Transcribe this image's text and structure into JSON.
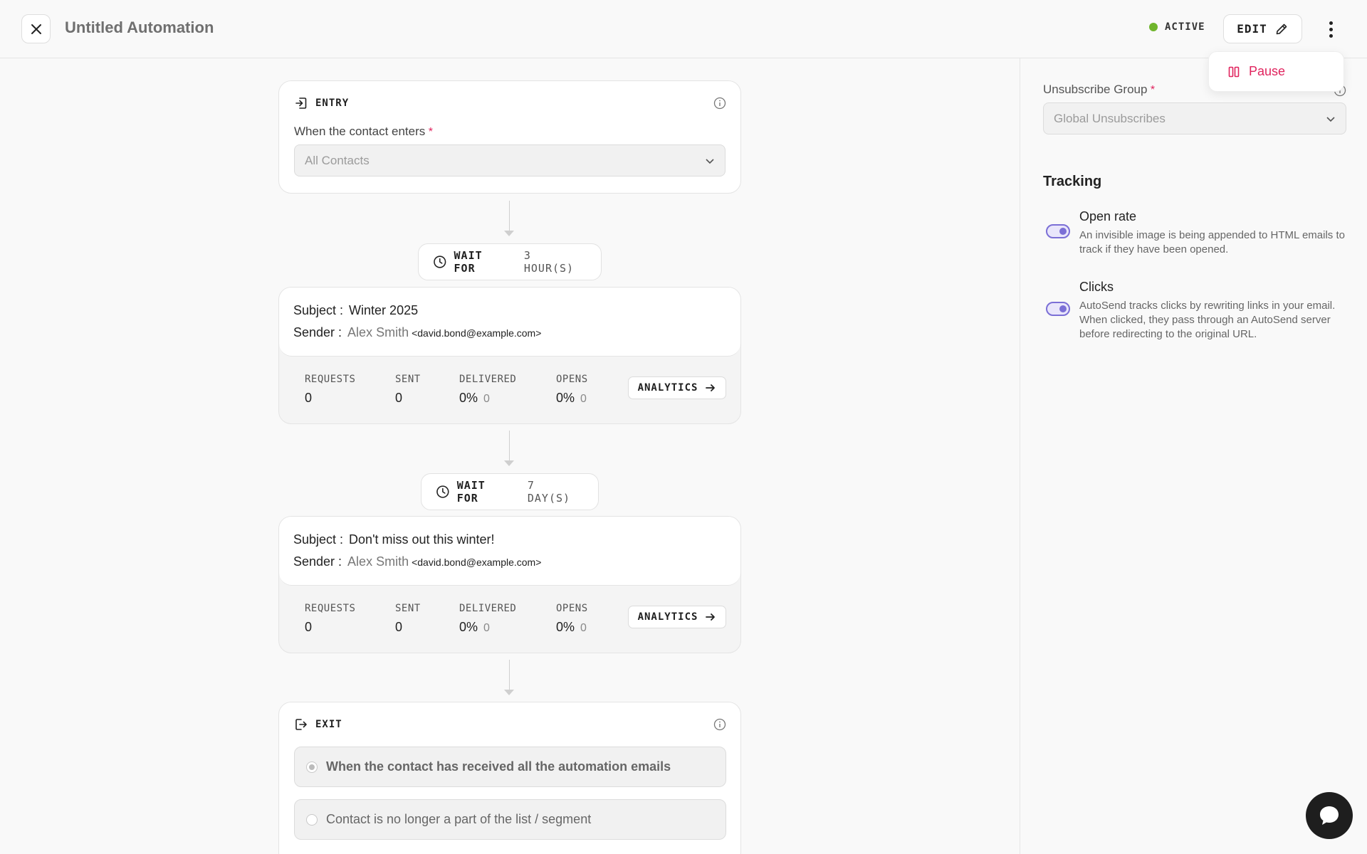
{
  "header": {
    "title": "Untitled Automation",
    "status": "ACTIVE",
    "edit_label": "EDIT"
  },
  "menu": {
    "pause_label": "Pause"
  },
  "entry": {
    "heading": "ENTRY",
    "field_label": "When the contact enters",
    "required_mark": "*",
    "selected": "All Contacts"
  },
  "waits": [
    {
      "label": "WAIT FOR",
      "value": "3 HOUR(S)"
    },
    {
      "label": "WAIT FOR",
      "value": "7 DAY(S)"
    }
  ],
  "emails": [
    {
      "subject_label": "Subject :",
      "subject": "Winter 2025",
      "sender_label": "Sender :",
      "sender_name": "Alex Smith",
      "sender_email": "<david.bond@example.com>",
      "stats": {
        "requests_label": "REQUESTS",
        "requests": "0",
        "sent_label": "SENT",
        "sent": "0",
        "delivered_label": "DELIVERED",
        "delivered": "0%",
        "delivered_count": "0",
        "opens_label": "OPENS",
        "opens": "0%",
        "opens_count": "0"
      },
      "analytics_label": "ANALYTICS"
    },
    {
      "subject_label": "Subject :",
      "subject": "Don't miss out this winter!",
      "sender_label": "Sender :",
      "sender_name": "Alex Smith",
      "sender_email": "<david.bond@example.com>",
      "stats": {
        "requests_label": "REQUESTS",
        "requests": "0",
        "sent_label": "SENT",
        "sent": "0",
        "delivered_label": "DELIVERED",
        "delivered": "0%",
        "delivered_count": "0",
        "opens_label": "OPENS",
        "opens": "0%",
        "opens_count": "0"
      },
      "analytics_label": "ANALYTICS"
    }
  ],
  "exit": {
    "heading": "EXIT",
    "options": [
      {
        "label": "When the contact has received all the automation emails",
        "checked": true
      },
      {
        "label": "Contact is no longer a part of the list / segment",
        "checked": false
      }
    ]
  },
  "panel": {
    "unsubscribe": {
      "label": "Unsubscribe Group",
      "required_mark": "*",
      "selected": "Global Unsubscribes"
    },
    "tracking": {
      "title": "Tracking",
      "open_rate": {
        "title": "Open rate",
        "desc": "An invisible image is being appended to HTML emails to track if they have been opened.",
        "enabled": true
      },
      "clicks": {
        "title": "Clicks",
        "desc": "AutoSend tracks clicks by rewriting links in your email. When clicked, they pass through an AutoSend server before redirecting to the original URL.",
        "enabled": true
      }
    }
  },
  "colors": {
    "accent": "#7b6fd6",
    "danger": "#e0245e",
    "active": "#6fb52c"
  }
}
